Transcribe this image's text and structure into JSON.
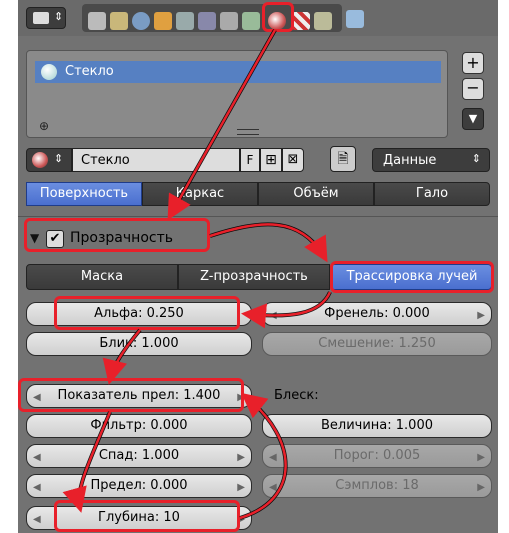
{
  "header": {
    "tab_icons": [
      "render-icon",
      "scene-icon",
      "world-icon",
      "object-icon",
      "constraints-icon",
      "modifiers-icon",
      "data-icon",
      "material-icon",
      "texture-icon",
      "particles-icon",
      "physics-icon"
    ]
  },
  "material_list": {
    "items": [
      "Стекло"
    ]
  },
  "material_selector": {
    "name": "Стекло",
    "fake_user": "F",
    "link_label": "Данные"
  },
  "display_tabs": [
    "Поверхность",
    "Каркас",
    "Объём",
    "Гало"
  ],
  "transparency": {
    "title": "Прозрачность",
    "checked": true,
    "modes": [
      "Маска",
      "Z-прозрачность",
      "Трассировка лучей"
    ],
    "active_mode": "Трассировка лучей"
  },
  "fields": {
    "alpha": "Альфа: 0.250",
    "fresnel": "Френель: 0.000",
    "specular": "Блик: 1.000",
    "blend": "Смешение: 1.250",
    "ior": "Показатель прел: 1.400",
    "gloss_label": "Блеск:",
    "filter": "Фильтр: 0.000",
    "amount": "Величина: 1.000",
    "falloff": "Спад: 1.000",
    "threshold": "Порог: 0.005",
    "limit": "Предел: 0.000",
    "samples": "Сэмплов: 18",
    "depth": "Глубина: 10"
  },
  "colors": {
    "highlight": "#e8202a",
    "active": "#5680c2",
    "panel": "#727272"
  }
}
